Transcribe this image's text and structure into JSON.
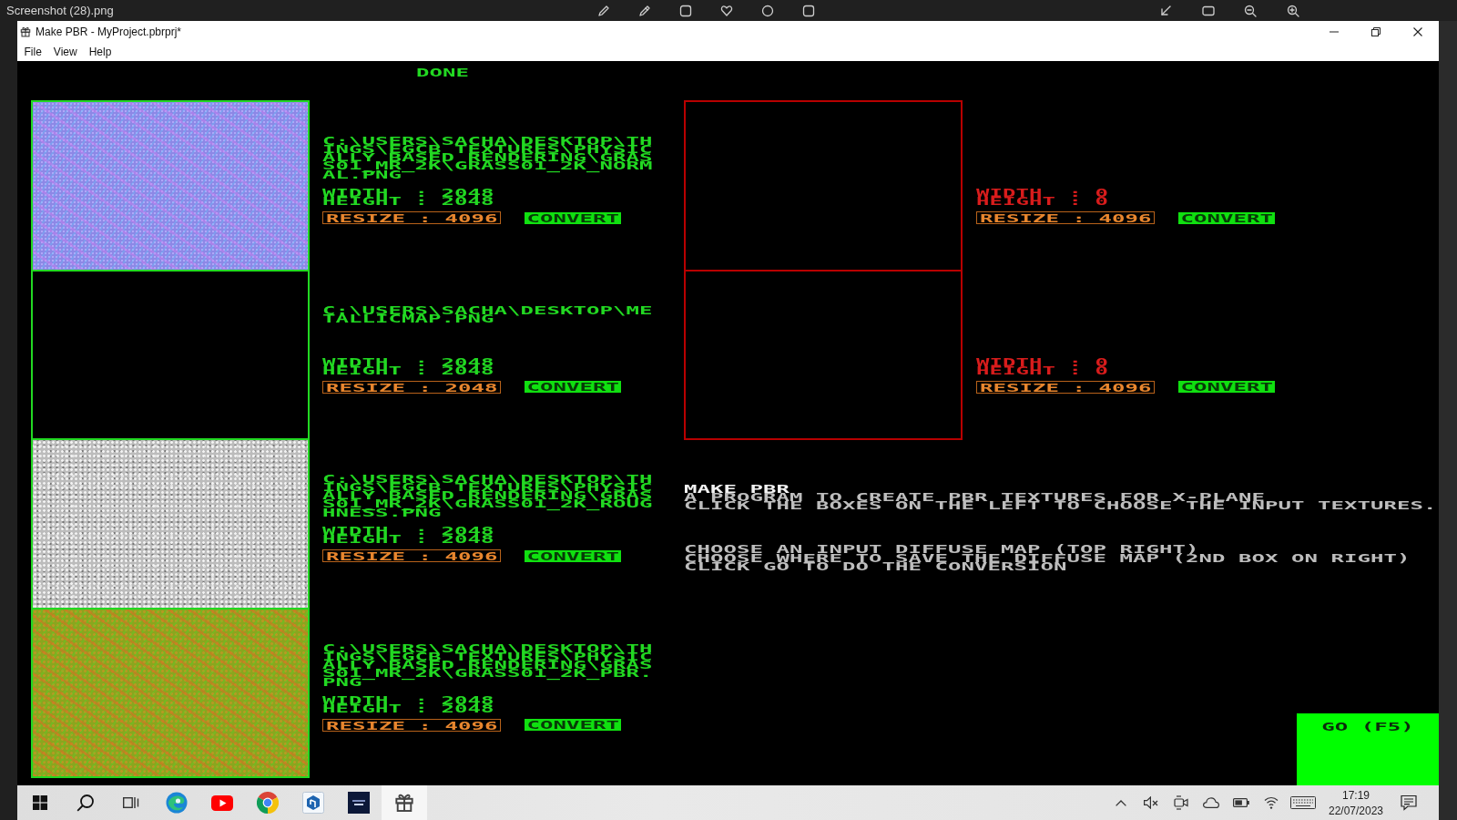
{
  "viewer": {
    "filename": "Screenshot (28).png"
  },
  "window": {
    "title": "Make PBR - MyProject.pbrprj*"
  },
  "menu": [
    {
      "label": "File"
    },
    {
      "label": "View"
    },
    {
      "label": "Help"
    }
  ],
  "status": "DONE",
  "input_slots": [
    {
      "kind": "normal",
      "loaded": true,
      "path": "C:\\USERS\\SACHA\\DESKTOP\\THINGS\\EGCB TEXTURES\\PHYSICALLY BASED RENDERING\\GRASS01_MR_2K\\GRASS01_2K_NORMAL.PNG",
      "width": "WIDTH  : 2048",
      "height": "HEIGHT : 2048",
      "resize": "RESIZE : 4096",
      "convert": "CONVERT"
    },
    {
      "kind": "black",
      "loaded": true,
      "path": "C:\\USERS\\SACHA\\DESKTOP\\METALLICMAP.PNG",
      "width": "WIDTH  : 2048",
      "height": "HEIGHT : 2048",
      "resize": "RESIZE : 2048",
      "convert": "CONVERT"
    },
    {
      "kind": "gray",
      "loaded": true,
      "path": "C:\\USERS\\SACHA\\DESKTOP\\THINGS\\EGCB TEXTURES\\PHYSICALLY BASED RENDERING\\GRASS01_MR_2K\\GRASS01_2K_ROUGHNESS.PNG",
      "width": "WIDTH  : 2048",
      "height": "HEIGHT : 2048",
      "resize": "RESIZE : 4096",
      "convert": "CONVERT"
    },
    {
      "kind": "color",
      "loaded": true,
      "path": "C:\\USERS\\SACHA\\DESKTOP\\THINGS\\EGCB TEXTURES\\PHYSICALLY BASED RENDERING\\GRASS01_MR_2K\\GRASS01_2K_PBR.PNG",
      "width": "WIDTH  : 2048",
      "height": "HEIGHT : 2048",
      "resize": "RESIZE : 4096",
      "convert": "CONVERT"
    }
  ],
  "output_slots": [
    {
      "loaded": false,
      "width": "WIDTH  : 0",
      "height": "HEIGHT : 0",
      "resize": "RESIZE : 4096",
      "convert": "CONVERT"
    },
    {
      "loaded": false,
      "width": "WIDTH  : 0",
      "height": "HEIGHT : 0",
      "resize": "RESIZE : 4096",
      "convert": "CONVERT"
    }
  ],
  "help": {
    "title": "MAKE PBR",
    "intro": [
      "A PROGRAM TO CREATE PBR TEXTURES FOR X-PLANE",
      "CLICK THE BOXES ON THE LEFT TO CHOOSE THE INPUT TEXTURES."
    ],
    "steps": [
      "CHOOSE AN INPUT DIFFUSE MAP (TOP RIGHT)",
      "CHOOSE WHERE TO SAVE THE DIFFUSE MAP (2ND BOX ON RIGHT)",
      "CLICK GO TO DO THE CONVERSION"
    ]
  },
  "go_button": "GO (F5)",
  "taskbar": {
    "apps": [
      {
        "kind": "swirl",
        "active": false
      },
      {
        "kind": "play",
        "active": false
      },
      {
        "kind": "tricolor",
        "active": false
      },
      {
        "kind": "cube",
        "active": false
      },
      {
        "kind": "tile",
        "active": false
      },
      {
        "kind": "gift",
        "active": true
      }
    ],
    "time": "17:19",
    "date": "22/07/2023"
  }
}
